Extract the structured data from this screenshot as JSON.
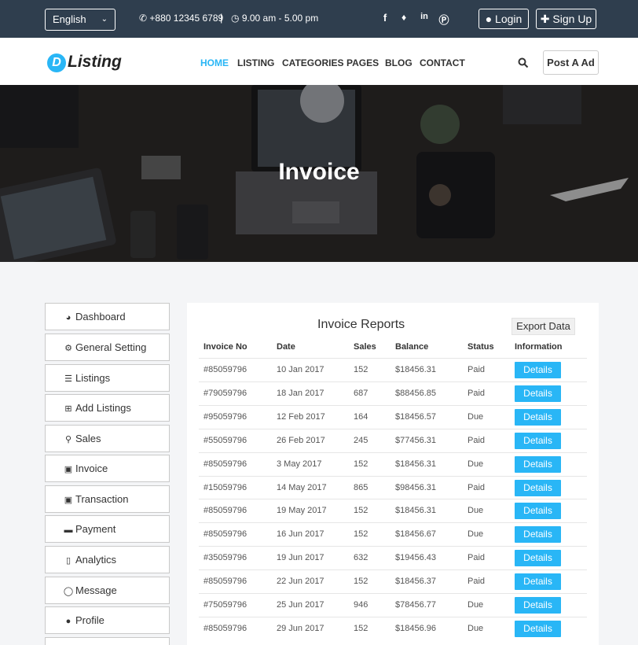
{
  "topbar": {
    "language": "English",
    "phone": "+880 12345 6789",
    "separator": "|",
    "hours": "9.00 am - 5.00 pm",
    "social_icons": [
      "facebook-icon",
      "twitter-icon",
      "linkedin-icon",
      "pinterest-icon"
    ],
    "login_label": "Login",
    "signup_label": "Sign Up"
  },
  "nav": {
    "logo_letter": "D",
    "logo_text": "Listing",
    "links": [
      "HOME",
      "LISTING",
      "CATEGORIES",
      "PAGES",
      "BLOG",
      "CONTACT"
    ],
    "active_link": "HOME",
    "post_ad_label": "Post A Ad"
  },
  "hero": {
    "title": "Invoice"
  },
  "sidebar": {
    "items": [
      {
        "label": "Dashboard",
        "icon": "dashboard-icon"
      },
      {
        "label": "General Setting",
        "icon": "gear-icon"
      },
      {
        "label": "Listings",
        "icon": "list-icon"
      },
      {
        "label": "Add Listings",
        "icon": "plus-square-icon"
      },
      {
        "label": "Sales",
        "icon": "cart-icon"
      },
      {
        "label": "Invoice",
        "icon": "file-icon"
      },
      {
        "label": "Transaction",
        "icon": "money-icon"
      },
      {
        "label": "Payment",
        "icon": "credit-card-icon"
      },
      {
        "label": "Analytics",
        "icon": "bar-chart-icon"
      },
      {
        "label": "Message",
        "icon": "comment-icon"
      },
      {
        "label": "Profile",
        "icon": "user-icon"
      }
    ]
  },
  "report": {
    "title": "Invoice Reports",
    "export_label": "Export Data",
    "columns": [
      "Invoice No",
      "Date",
      "Sales",
      "Balance",
      "Status",
      "Information"
    ],
    "details_label": "Details",
    "rows": [
      [
        "#85059796",
        "10 Jan 2017",
        "152",
        "$18456.31",
        "Paid"
      ],
      [
        "#79059796",
        "18 Jan 2017",
        "687",
        "$88456.85",
        "Paid"
      ],
      [
        "#95059796",
        "12 Feb 2017",
        "164",
        "$18456.57",
        "Due"
      ],
      [
        "#55059796",
        "26 Feb 2017",
        "245",
        "$77456.31",
        "Paid"
      ],
      [
        "#85059796",
        "3 May 2017",
        "152",
        "$18456.31",
        "Due"
      ],
      [
        "#15059796",
        "14 May 2017",
        "865",
        "$98456.31",
        "Paid"
      ],
      [
        "#85059796",
        "19 May 2017",
        "152",
        "$18456.31",
        "Due"
      ],
      [
        "#85059796",
        "16 Jun 2017",
        "152",
        "$18456.67",
        "Due"
      ],
      [
        "#35059796",
        "19 Jun 2017",
        "632",
        "$19456.43",
        "Paid"
      ],
      [
        "#85059796",
        "22 Jun 2017",
        "152",
        "$18456.37",
        "Paid"
      ],
      [
        "#75059796",
        "25 Jun 2017",
        "946",
        "$78456.77",
        "Due"
      ],
      [
        "#85059796",
        "29 Jun 2017",
        "152",
        "$18456.96",
        "Due"
      ]
    ]
  },
  "colors": {
    "accent": "#29b6f6",
    "topbar": "#2f3e4e"
  }
}
